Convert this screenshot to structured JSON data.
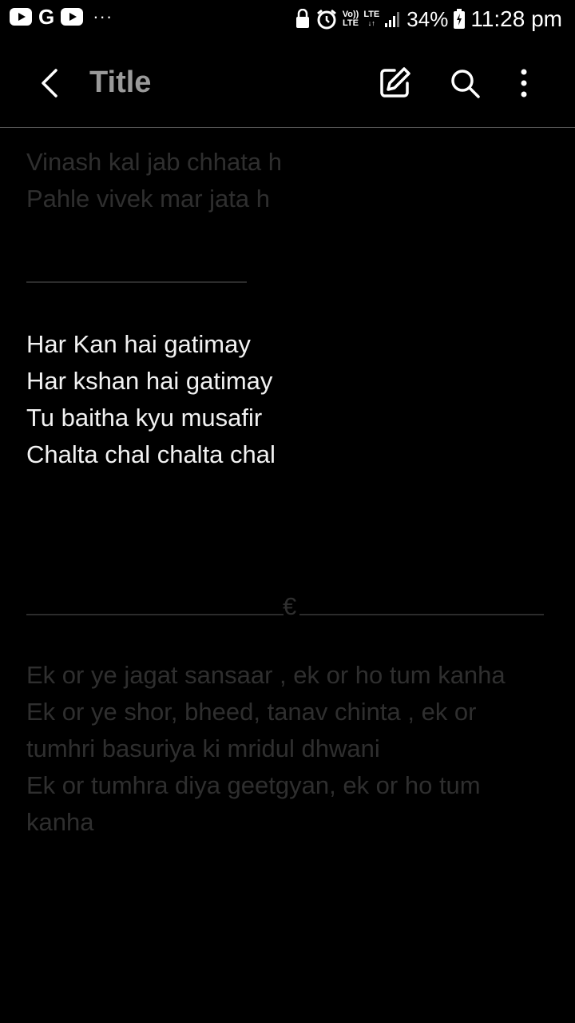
{
  "status_bar": {
    "google_letter": "G",
    "more_dots": "···",
    "volte_top": "Vo))",
    "volte_bottom": "LTE",
    "lte_label": "LTE",
    "battery": "34%",
    "time": "11:28 pm"
  },
  "toolbar": {
    "title": "Title"
  },
  "note": {
    "block1": [
      "Vinash kal jab chhata h",
      "Pahle vivek mar jata h"
    ],
    "block2": [
      "Har Kan hai gatimay",
      "Har kshan hai gatimay",
      "Tu baitha kyu musafir",
      "Chalta chal chalta chal"
    ],
    "separator_symbol": "€",
    "block3": [
      "Ek or ye jagat sansaar , ek or ho tum kanha",
      "Ek or ye shor, bheed, tanav chinta , ek or",
      "tumhri basuriya ki mridul dhwani",
      "Ek or tumhra diya geetgyan, ek or ho tum",
      "kanha"
    ]
  },
  "colors": {
    "background": "#000000",
    "text_bright": "#f2f2f2",
    "text_dim": "#2f2f2f",
    "title": "#9a9a9a"
  }
}
